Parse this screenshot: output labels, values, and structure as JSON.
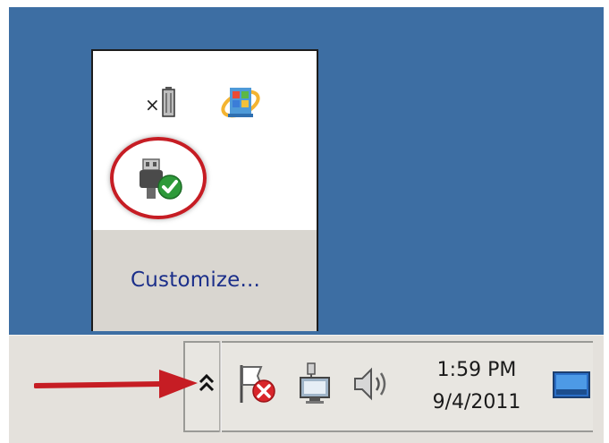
{
  "overflow_popup": {
    "customize_link": "Customize...",
    "icons": [
      "no-device-battery-icon",
      "windows-update-icon",
      "safely-remove-hardware-icon"
    ],
    "highlighted_icon": "safely-remove-hardware-icon"
  },
  "taskbar": {
    "tray_icons": [
      "show-hidden-icons-chevron-icon",
      "action-center-flag-icon",
      "network-icon",
      "volume-icon",
      "show-desktop-icon"
    ],
    "clock": {
      "time": "1:59 PM",
      "date": "9/4/2011"
    }
  },
  "colors": {
    "desktop_background": "#3d6ea3",
    "highlight_ring": "#c61d24",
    "arrow": "#c61d24",
    "link": "#1b2f8a"
  }
}
